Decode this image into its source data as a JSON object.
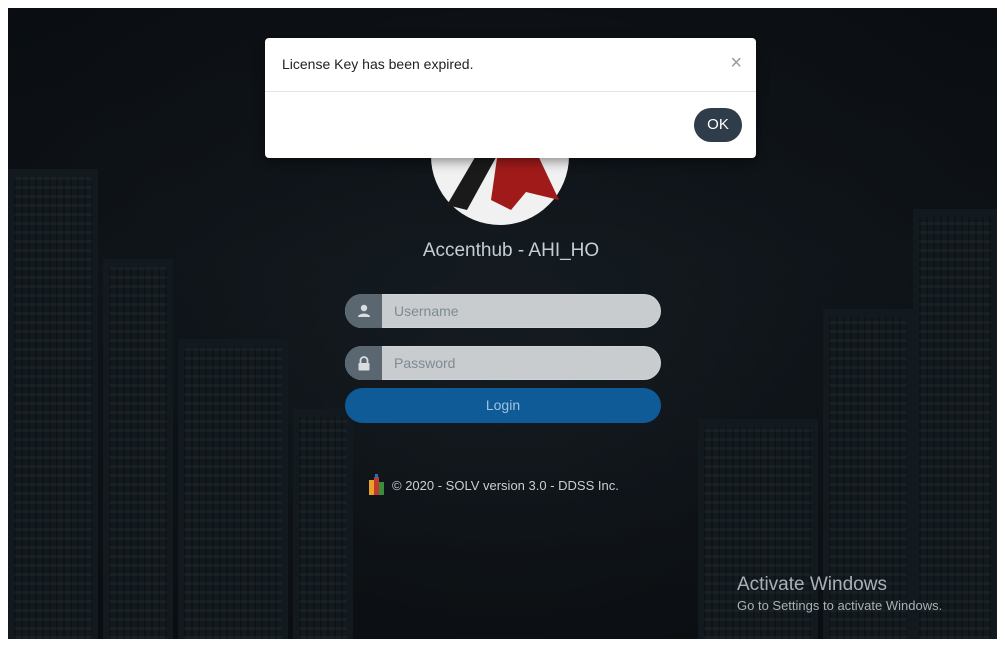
{
  "modal": {
    "message": "License Key has been expired.",
    "close_symbol": "×",
    "ok_label": "OK"
  },
  "login": {
    "app_title": "Accenthub - AHI_HO",
    "username_placeholder": "Username",
    "password_placeholder": "Password",
    "login_label": "Login",
    "copyright": "© 2020 - SOLV version 3.0 - DDSS Inc."
  },
  "watermark": {
    "title": "Activate Windows",
    "subtitle": "Go to Settings to activate Windows."
  },
  "colors": {
    "login_button": "#0e5b98",
    "ok_button": "#2f3c49",
    "logo_red": "#a11a1a"
  },
  "icons": {
    "username": "user-icon",
    "password": "lock-icon",
    "copyright_logo": "app-logo-icon"
  }
}
